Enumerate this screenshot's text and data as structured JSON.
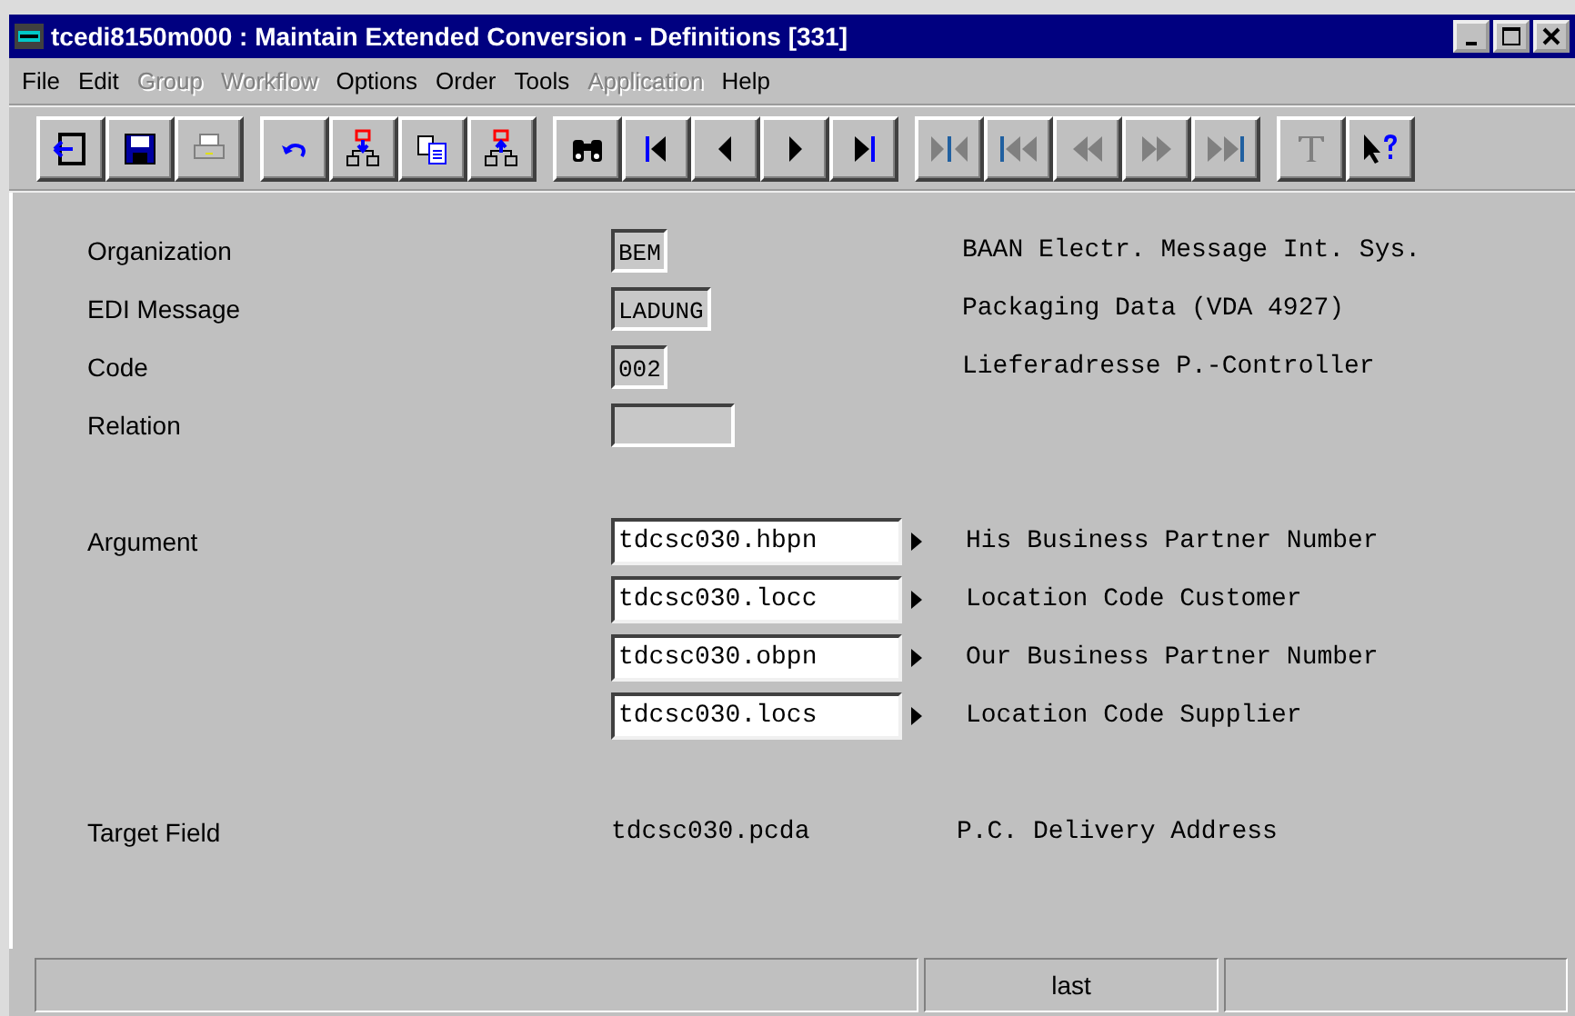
{
  "window": {
    "title": "tcedi8150m000 : Maintain Extended Conversion - Definitions [331]"
  },
  "menu": [
    {
      "label": "File",
      "disabled": false
    },
    {
      "label": "Edit",
      "disabled": false
    },
    {
      "label": "Group",
      "disabled": true
    },
    {
      "label": "Workflow",
      "disabled": true
    },
    {
      "label": "Options",
      "disabled": false
    },
    {
      "label": "Order",
      "disabled": false
    },
    {
      "label": "Tools",
      "disabled": false
    },
    {
      "label": "Application",
      "disabled": true
    },
    {
      "label": "Help",
      "disabled": false
    }
  ],
  "toolbar": [
    [
      {
        "kind": "exit",
        "disabled": false
      },
      {
        "kind": "save",
        "disabled": false
      },
      {
        "kind": "print",
        "disabled": true
      }
    ],
    [
      {
        "kind": "undo",
        "disabled": false
      },
      {
        "kind": "insert",
        "disabled": false
      },
      {
        "kind": "copy",
        "disabled": false
      },
      {
        "kind": "insert-up",
        "disabled": false
      }
    ],
    [
      {
        "kind": "find",
        "disabled": false
      },
      {
        "kind": "first",
        "disabled": false
      },
      {
        "kind": "prev",
        "disabled": false
      },
      {
        "kind": "next",
        "disabled": false
      },
      {
        "kind": "last",
        "disabled": false
      }
    ],
    [
      {
        "kind": "mark-first",
        "disabled": true
      },
      {
        "kind": "page-first",
        "disabled": true
      },
      {
        "kind": "page-prev",
        "disabled": true
      },
      {
        "kind": "page-next",
        "disabled": true
      },
      {
        "kind": "page-last",
        "disabled": true
      }
    ],
    [
      {
        "kind": "text",
        "disabled": true
      },
      {
        "kind": "help",
        "disabled": false
      }
    ]
  ],
  "fields": [
    {
      "label": "Organization",
      "value": "BEM",
      "description": "BAAN Electr. Message Int. Sys."
    },
    {
      "label": "EDI Message",
      "value": "LADUNG",
      "description": "Packaging Data (VDA 4927)"
    },
    {
      "label": "Code",
      "value": "002",
      "description": "Lieferadresse P.-Controller"
    },
    {
      "label": "Relation"
    }
  ],
  "arguments": {
    "label": "Argument",
    "entries": [
      {
        "value": "tdcsc030.hbpn",
        "description": "His Business Partner Number"
      },
      {
        "value": "tdcsc030.locc",
        "description": "Location Code Customer"
      },
      {
        "value": "tdcsc030.obpn",
        "description": "Our Business Partner Number"
      },
      {
        "value": "tdcsc030.locs",
        "description": "Location Code Supplier"
      }
    ]
  },
  "target": {
    "label": "Target Field",
    "value": "tdcsc030.pcda",
    "description": "P.C. Delivery Address"
  },
  "status_bar": {
    "message": "last"
  }
}
